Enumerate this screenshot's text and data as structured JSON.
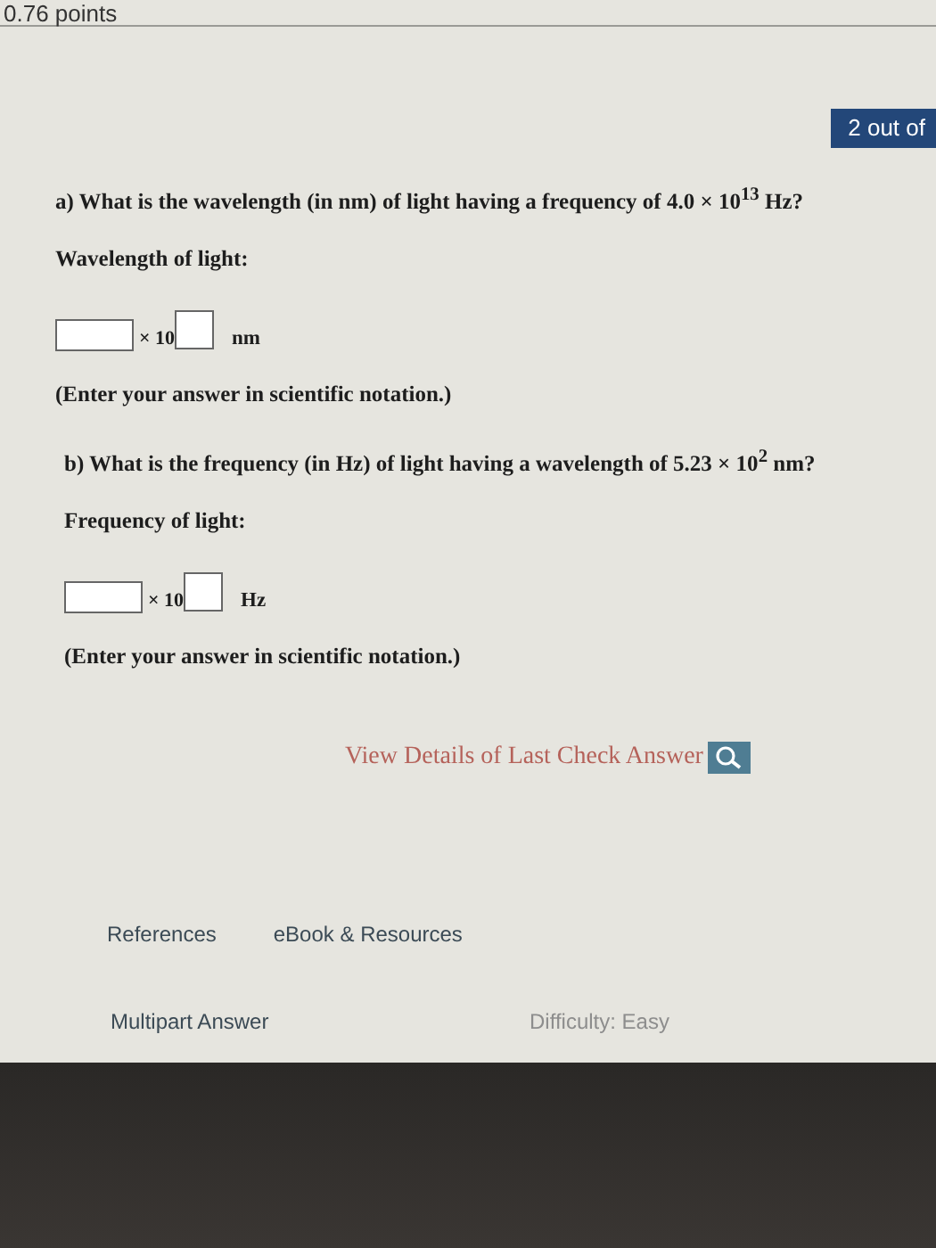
{
  "header": {
    "points": "0.76 points",
    "progress": "2 out of"
  },
  "parts": [
    {
      "question": "a) What is the wavelength (in nm) of light having a frequency of 4.0 × 10$^{13}$ Hz?",
      "label": "Wavelength of light:",
      "times": "× 10",
      "unit": "nm",
      "note": "(Enter your answer in scientific notation.)"
    },
    {
      "question": "b) What is the frequency (in Hz) of light having a wavelength of 5.23 × 10$^{2}$ nm?",
      "label": "Frequency of light:",
      "times": "× 10",
      "unit": "Hz",
      "note": "(Enter your answer in scientific notation.)"
    }
  ],
  "check_link": "View Details of Last Check Answer",
  "links": [
    "References",
    "eBook & Resources"
  ],
  "footer": {
    "type": "Multipart Answer",
    "difficulty": "Difficulty: Easy"
  }
}
